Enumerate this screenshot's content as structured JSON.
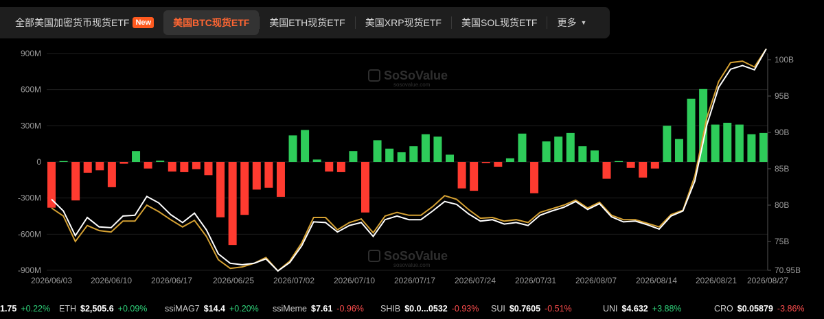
{
  "tabs": [
    {
      "label": "全部美国加密货币现货ETF",
      "badge": "New",
      "active": false
    },
    {
      "label": "美国BTC现货ETF",
      "active": true
    },
    {
      "label": "美国ETH现货ETF",
      "active": false
    },
    {
      "label": "美国XRP现货ETF",
      "active": false
    },
    {
      "label": "美国SOL现货ETF",
      "active": false
    }
  ],
  "more_label": "更多",
  "watermark": {
    "name": "SoSoValue",
    "domain": "sosovalue.com"
  },
  "colors": {
    "inflow": "#2ecc5a",
    "outflow": "#ff3b30",
    "line_white": "#ffffff",
    "line_gold": "#d4a032"
  },
  "chart_data": {
    "type": "bar",
    "x_tick_labels": [
      "2026/06/03",
      "2026/06/10",
      "2026/06/17",
      "2026/06/25",
      "2026/07/02",
      "2026/07/10",
      "2026/07/17",
      "2026/07/24",
      "2026/07/31",
      "2026/08/07",
      "2026/08/14",
      "2026/08/21",
      "2026/08/27"
    ],
    "y_left": {
      "ticks": [
        "900M",
        "600M",
        "300M",
        "0",
        "-300M",
        "-600M",
        "-900M"
      ],
      "range": [
        -900,
        900
      ],
      "unit": "M"
    },
    "y_right": {
      "ticks": [
        "100B",
        "95B",
        "90B",
        "85B",
        "80B",
        "75B",
        "70.95B"
      ],
      "values": [
        100,
        95,
        90,
        85,
        80,
        75,
        70.95
      ],
      "range": [
        70.95,
        101.5
      ],
      "unit": "B"
    },
    "bars": [
      -380,
      5,
      -320,
      -90,
      -70,
      -210,
      -15,
      90,
      -55,
      10,
      -80,
      -85,
      -60,
      -110,
      -460,
      -690,
      -440,
      -230,
      -215,
      -290,
      220,
      265,
      20,
      -80,
      -85,
      90,
      -420,
      180,
      110,
      80,
      130,
      230,
      210,
      60,
      -220,
      -240,
      -10,
      -40,
      30,
      235,
      -260,
      170,
      210,
      240,
      130,
      95,
      -140,
      5,
      -50,
      -130,
      -55,
      300,
      190,
      525,
      605,
      310,
      325,
      310,
      230,
      240
    ],
    "series": [
      {
        "name": "",
        "values": [
          79.6,
          78.5,
          75.0,
          77.2,
          76.5,
          76.3,
          77.8,
          77.8,
          80.0,
          79.1,
          78.0,
          77.0,
          77.9,
          75.7,
          72.5,
          71.3,
          71.5,
          72.0,
          72.8,
          70.95,
          72.3,
          74.8,
          78.3,
          78.3,
          76.6,
          77.6,
          78.1,
          76.2,
          78.5,
          79.0,
          78.6,
          78.6,
          79.8,
          81.3,
          80.8,
          79.4,
          78.2,
          78.3,
          77.8,
          78.0,
          77.6,
          79.0,
          79.5,
          80.0,
          80.7,
          79.6,
          80.4,
          78.6,
          78.0,
          78.0,
          77.5,
          77.0,
          78.7,
          79.3,
          84.0,
          92.0,
          97.0,
          99.6,
          99.8,
          99.0,
          101.5
        ]
      },
      {
        "name": "",
        "values": [
          80.8,
          79.2,
          75.8,
          78.3,
          77.0,
          76.9,
          78.5,
          78.6,
          81.2,
          80.3,
          78.7,
          77.6,
          78.9,
          76.6,
          73.3,
          72.0,
          71.8,
          72.0,
          72.6,
          70.95,
          72.1,
          74.4,
          77.7,
          77.6,
          76.3,
          77.2,
          77.6,
          75.7,
          78.0,
          78.5,
          78.0,
          78.0,
          79.2,
          80.5,
          80.1,
          78.8,
          77.8,
          78.0,
          77.4,
          77.6,
          77.2,
          78.6,
          79.2,
          79.7,
          80.5,
          79.4,
          80.2,
          78.4,
          77.7,
          77.8,
          77.3,
          76.7,
          78.5,
          79.2,
          83.3,
          91.0,
          96.2,
          98.7,
          99.2,
          98.6,
          101.5
        ]
      }
    ]
  },
  "ticker": [
    {
      "name": "",
      "price": "1.75",
      "change": "+0.22%",
      "dir": "up"
    },
    {
      "name": "ETH",
      "price": "$2,505.6",
      "change": "+0.09%",
      "dir": "up"
    },
    {
      "name": "ssiMAG7",
      "price": "$14.4",
      "change": "+0.20%",
      "dir": "up"
    },
    {
      "name": "ssiMeme",
      "price": "$7.61",
      "change": "-0.96%",
      "dir": "dn"
    },
    {
      "name": "SHIB",
      "price": "$0.0...0532",
      "change": "-0.93%",
      "dir": "dn"
    },
    {
      "name": "SUI",
      "price": "$0.7605",
      "change": "-0.51%",
      "dir": "dn"
    },
    {
      "name": "UNI",
      "price": "$4.632",
      "change": "+3.88%",
      "dir": "up"
    },
    {
      "name": "CRO",
      "price": "$0.05879",
      "change": "-3.86%",
      "dir": "dn"
    }
  ]
}
